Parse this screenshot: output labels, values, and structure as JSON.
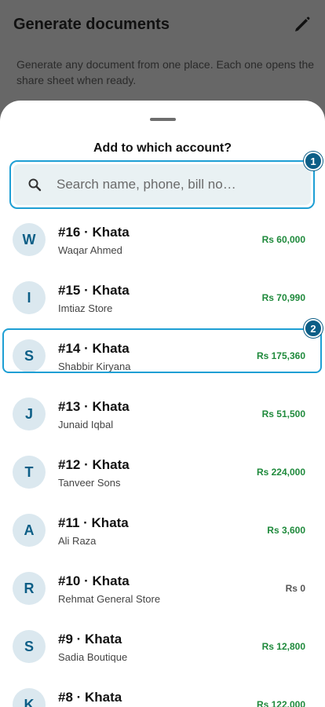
{
  "background": {
    "title": "Generate documents",
    "description": "Generate any document from one place. Each one opens the share sheet when ready."
  },
  "sheet": {
    "title": "Add to which account?",
    "search": {
      "placeholder": "Search name, phone, bill no…",
      "value": ""
    },
    "badges": {
      "search": "1",
      "selected_row": "2"
    }
  },
  "accounts": [
    {
      "initial": "W",
      "title": "#16 · Khata",
      "name": "Waqar Ahmed",
      "amount": "Rs 60,000"
    },
    {
      "initial": "I",
      "title": "#15 · Khata",
      "name": "Imtiaz Store",
      "amount": "Rs 70,990"
    },
    {
      "initial": "S",
      "title": "#14 · Khata",
      "name": "Shabbir Kiryana",
      "amount": "Rs 175,360"
    },
    {
      "initial": "J",
      "title": "#13 · Khata",
      "name": "Junaid Iqbal",
      "amount": "Rs 51,500"
    },
    {
      "initial": "T",
      "title": "#12 · Khata",
      "name": "Tanveer Sons",
      "amount": "Rs 224,000"
    },
    {
      "initial": "A",
      "title": "#11 · Khata",
      "name": "Ali Raza",
      "amount": "Rs 3,600"
    },
    {
      "initial": "R",
      "title": "#10 · Khata",
      "name": "Rehmat General Store",
      "amount": "Rs 0"
    },
    {
      "initial": "S",
      "title": "#9 · Khata",
      "name": "Sadia Boutique",
      "amount": "Rs 12,800"
    },
    {
      "initial": "K",
      "title": "#8 · Khata",
      "name": "",
      "amount": "Rs 122,000"
    }
  ],
  "colors": {
    "accent": "#1e9fd4",
    "badge": "#0c5e86",
    "amount_positive": "#1f8a3c"
  }
}
